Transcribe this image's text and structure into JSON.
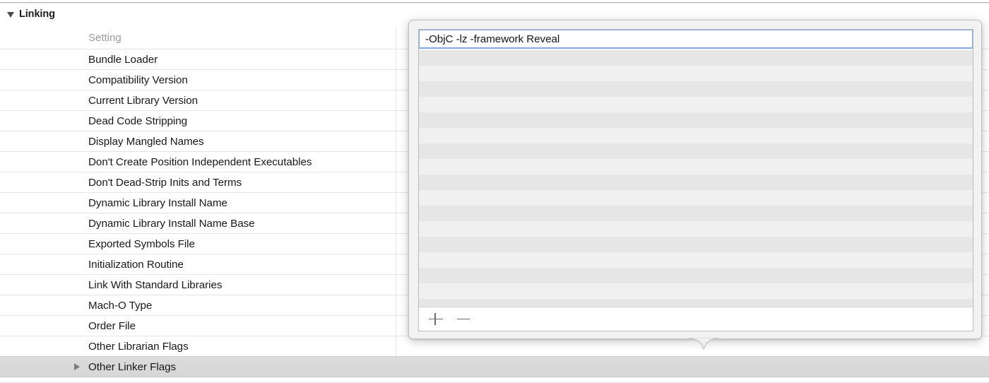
{
  "window": {
    "context": "xcode-build-settings-linking"
  },
  "group": {
    "title": "Linking",
    "disclosure_icon": "disclosure-triangle-down-icon",
    "expanded": true
  },
  "settings_table": {
    "column_header": "Setting",
    "rows": [
      {
        "label": "Bundle Loader",
        "has_disclosure": false,
        "selected": false
      },
      {
        "label": "Compatibility Version",
        "has_disclosure": false,
        "selected": false
      },
      {
        "label": "Current Library Version",
        "has_disclosure": false,
        "selected": false
      },
      {
        "label": "Dead Code Stripping",
        "has_disclosure": false,
        "selected": false
      },
      {
        "label": "Display Mangled Names",
        "has_disclosure": false,
        "selected": false
      },
      {
        "label": "Don't Create Position Independent Executables",
        "has_disclosure": false,
        "selected": false
      },
      {
        "label": "Don't Dead-Strip Inits and Terms",
        "has_disclosure": false,
        "selected": false
      },
      {
        "label": "Dynamic Library Install Name",
        "has_disclosure": false,
        "selected": false
      },
      {
        "label": "Dynamic Library Install Name Base",
        "has_disclosure": false,
        "selected": false
      },
      {
        "label": "Exported Symbols File",
        "has_disclosure": false,
        "selected": false
      },
      {
        "label": "Initialization Routine",
        "has_disclosure": false,
        "selected": false
      },
      {
        "label": "Link With Standard Libraries",
        "has_disclosure": false,
        "selected": false
      },
      {
        "label": "Mach-O Type",
        "has_disclosure": false,
        "selected": false
      },
      {
        "label": "Order File",
        "has_disclosure": false,
        "selected": false
      },
      {
        "label": "Other Librarian Flags",
        "has_disclosure": false,
        "selected": false
      },
      {
        "label": "Other Linker Flags",
        "has_disclosure": true,
        "selected": true
      }
    ]
  },
  "popover": {
    "value_field": {
      "value": "-ObjC -lz -framework Reveal",
      "placeholder": "",
      "focused": true
    },
    "empty_rows_count": 18,
    "toolbar": {
      "add_label": "+",
      "remove_label": "−",
      "add_icon": "plus-icon",
      "remove_icon": "minus-icon"
    },
    "tail_direction": "down"
  },
  "colors": {
    "focus_ring": "#7fa9de",
    "selected_row": "#d8d8d8",
    "stripe_dark": "#e6e6e6",
    "stripe_light": "#f0f0f0",
    "popover_chrome": "#f2f2f2",
    "row_divider": "#e6e6e6",
    "header_text": "#9a9a9a",
    "label_text": "#181818"
  }
}
